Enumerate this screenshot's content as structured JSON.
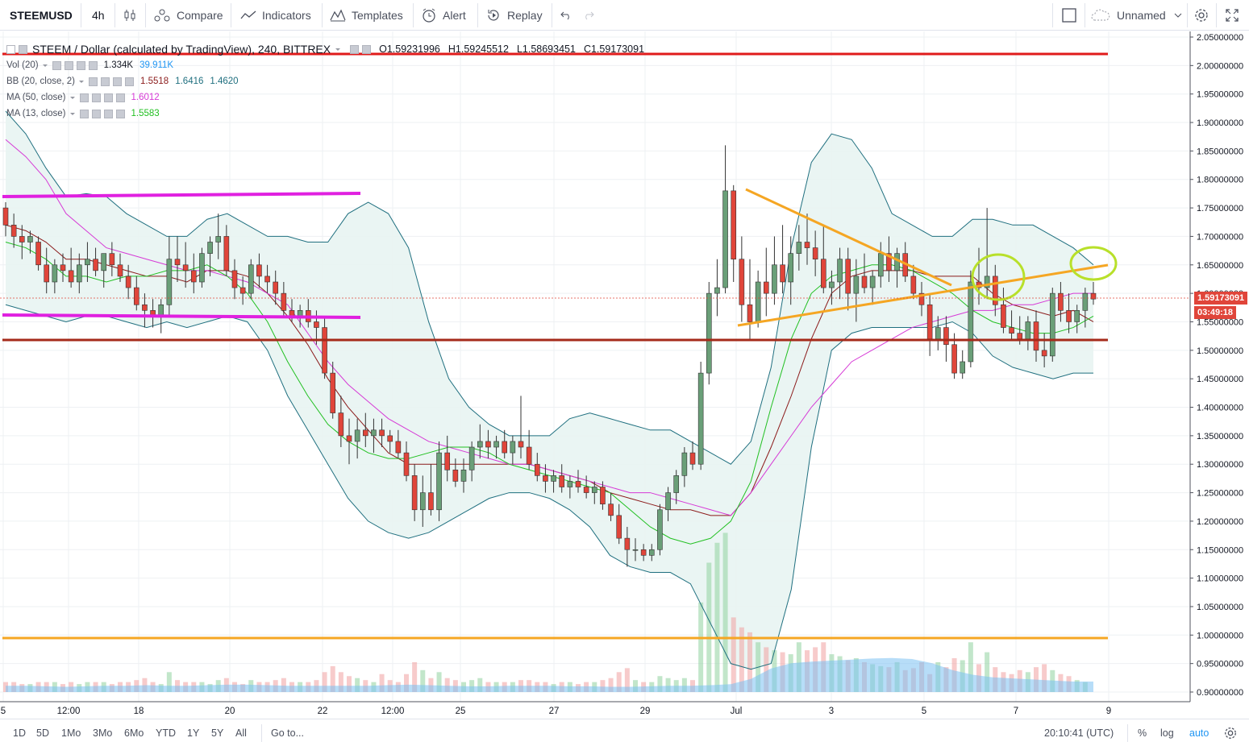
{
  "toolbar": {
    "symbol": "STEEMUSD",
    "interval": "4h",
    "compare_label": "Compare",
    "indicators_label": "Indicators",
    "templates_label": "Templates",
    "alert_label": "Alert",
    "replay_label": "Replay",
    "layout_name": "Unnamed"
  },
  "legend": {
    "title": "STEEM / Dollar (calculated by TradingView), 240, BITTREX",
    "open": "O1.59231996",
    "high": "H1.59245512",
    "low": "L1.58693451",
    "close": "C1.59173091",
    "indicators": [
      {
        "name": "Vol (20)",
        "values": [
          "1.334K",
          "39.911K"
        ],
        "colors": [
          "#131722",
          "#2196f3"
        ]
      },
      {
        "name": "BB (20, close, 2)",
        "values": [
          "1.5518",
          "1.6416",
          "1.4620"
        ],
        "colors": [
          "#8b1a1a",
          "#1f6f7f",
          "#1f6f7f"
        ]
      },
      {
        "name": "MA (50, close)",
        "values": [
          "1.6012"
        ],
        "colors": [
          "#d63ad6"
        ]
      },
      {
        "name": "MA (13, close)",
        "values": [
          "1.5583"
        ],
        "colors": [
          "#22c022"
        ]
      }
    ]
  },
  "price_axis": {
    "ticks": [
      "2.05000000",
      "2.00000000",
      "1.95000000",
      "1.90000000",
      "1.85000000",
      "1.80000000",
      "1.75000000",
      "1.70000000",
      "1.65000000",
      "1.60000000",
      "1.55000000",
      "1.50000000",
      "1.45000000",
      "1.40000000",
      "1.35000000",
      "1.30000000",
      "1.25000000",
      "1.20000000",
      "1.15000000",
      "1.10000000",
      "1.05000000",
      "1.00000000",
      "0.95000000",
      "0.90000000"
    ],
    "last_price": "1.59173091",
    "countdown": "03:49:18"
  },
  "time_axis": {
    "ticks": [
      "5",
      "12:00",
      "18",
      "20",
      "22",
      "12:00",
      "25",
      "27",
      "29",
      "Jul",
      "3",
      "5",
      "7",
      "9"
    ]
  },
  "bottom_bar": {
    "ranges": [
      "1D",
      "5D",
      "1Mo",
      "3Mo",
      "6Mo",
      "YTD",
      "1Y",
      "5Y",
      "All"
    ],
    "goto_label": "Go to...",
    "clock": "20:10:41 (UTC)",
    "percent_label": "%",
    "log_label": "log",
    "auto_label": "auto"
  },
  "colors": {
    "up_candle": "#6a9f78",
    "down_candle": "#e0453a",
    "red_line": "#e01b1b",
    "dark_red_line": "#a52a1a",
    "orange_line": "#f5a623",
    "magenta_line": "#e020e0",
    "highlight_circle": "#b8e02a",
    "bb_fill": "#e8f4f2",
    "bb_band": "#1f6f7f",
    "bb_basis": "#8b1a1a",
    "ma50": "#d63ad6",
    "ma13": "#22c022",
    "volume_up": "#8fd19e",
    "volume_down": "#f0a0a0",
    "volume_ma": "#7cc1f2"
  },
  "chart_data": {
    "type": "candlestick",
    "symbol": "STEEMUSD",
    "interval": "240",
    "ylim": [
      0.88,
      2.06
    ],
    "x_ticks": [
      "5",
      "12:00",
      "18",
      "20",
      "22",
      "12:00",
      "25",
      "27",
      "29",
      "Jul",
      "3",
      "5",
      "7",
      "9"
    ],
    "candles": [
      [
        1.75,
        1.76,
        1.7,
        1.72
      ],
      [
        1.72,
        1.74,
        1.68,
        1.7
      ],
      [
        1.7,
        1.72,
        1.66,
        1.69
      ],
      [
        1.69,
        1.71,
        1.67,
        1.7
      ],
      [
        1.69,
        1.7,
        1.64,
        1.65
      ],
      [
        1.65,
        1.68,
        1.6,
        1.62
      ],
      [
        1.62,
        1.66,
        1.6,
        1.65
      ],
      [
        1.65,
        1.67,
        1.62,
        1.64
      ],
      [
        1.64,
        1.68,
        1.61,
        1.62
      ],
      [
        1.62,
        1.67,
        1.6,
        1.65
      ],
      [
        1.65,
        1.69,
        1.62,
        1.66
      ],
      [
        1.66,
        1.68,
        1.63,
        1.64
      ],
      [
        1.64,
        1.67,
        1.61,
        1.67
      ],
      [
        1.67,
        1.69,
        1.63,
        1.65
      ],
      [
        1.65,
        1.67,
        1.62,
        1.63
      ],
      [
        1.63,
        1.65,
        1.59,
        1.61
      ],
      [
        1.61,
        1.63,
        1.57,
        1.58
      ],
      [
        1.58,
        1.6,
        1.54,
        1.57
      ],
      [
        1.57,
        1.59,
        1.54,
        1.56
      ],
      [
        1.56,
        1.59,
        1.53,
        1.58
      ],
      [
        1.58,
        1.7,
        1.56,
        1.66
      ],
      [
        1.66,
        1.7,
        1.62,
        1.65
      ],
      [
        1.65,
        1.69,
        1.61,
        1.64
      ],
      [
        1.64,
        1.67,
        1.6,
        1.62
      ],
      [
        1.62,
        1.68,
        1.61,
        1.67
      ],
      [
        1.67,
        1.7,
        1.63,
        1.69
      ],
      [
        1.69,
        1.74,
        1.66,
        1.7
      ],
      [
        1.7,
        1.72,
        1.63,
        1.64
      ],
      [
        1.64,
        1.66,
        1.59,
        1.61
      ],
      [
        1.61,
        1.63,
        1.58,
        1.6
      ],
      [
        1.6,
        1.66,
        1.59,
        1.65
      ],
      [
        1.65,
        1.67,
        1.61,
        1.63
      ],
      [
        1.63,
        1.65,
        1.6,
        1.62
      ],
      [
        1.62,
        1.64,
        1.58,
        1.6
      ],
      [
        1.6,
        1.62,
        1.56,
        1.57
      ],
      [
        1.57,
        1.59,
        1.55,
        1.56
      ],
      [
        1.56,
        1.58,
        1.54,
        1.57
      ],
      [
        1.57,
        1.59,
        1.54,
        1.55
      ],
      [
        1.55,
        1.57,
        1.51,
        1.54
      ],
      [
        1.54,
        1.56,
        1.45,
        1.46
      ],
      [
        1.46,
        1.48,
        1.38,
        1.39
      ],
      [
        1.39,
        1.42,
        1.33,
        1.35
      ],
      [
        1.35,
        1.38,
        1.3,
        1.34
      ],
      [
        1.34,
        1.38,
        1.31,
        1.36
      ],
      [
        1.36,
        1.39,
        1.33,
        1.35
      ],
      [
        1.35,
        1.38,
        1.32,
        1.36
      ],
      [
        1.36,
        1.38,
        1.33,
        1.35
      ],
      [
        1.35,
        1.36,
        1.32,
        1.34
      ],
      [
        1.34,
        1.36,
        1.31,
        1.32
      ],
      [
        1.32,
        1.34,
        1.27,
        1.28
      ],
      [
        1.28,
        1.3,
        1.2,
        1.22
      ],
      [
        1.22,
        1.28,
        1.19,
        1.25
      ],
      [
        1.25,
        1.3,
        1.21,
        1.22
      ],
      [
        1.22,
        1.34,
        1.2,
        1.32
      ],
      [
        1.32,
        1.35,
        1.27,
        1.29
      ],
      [
        1.29,
        1.31,
        1.26,
        1.27
      ],
      [
        1.27,
        1.31,
        1.25,
        1.29
      ],
      [
        1.29,
        1.34,
        1.27,
        1.33
      ],
      [
        1.33,
        1.37,
        1.31,
        1.34
      ],
      [
        1.34,
        1.36,
        1.31,
        1.33
      ],
      [
        1.33,
        1.35,
        1.31,
        1.34
      ],
      [
        1.34,
        1.36,
        1.31,
        1.32
      ],
      [
        1.32,
        1.35,
        1.3,
        1.34
      ],
      [
        1.34,
        1.42,
        1.31,
        1.33
      ],
      [
        1.33,
        1.36,
        1.29,
        1.3
      ],
      [
        1.3,
        1.32,
        1.27,
        1.28
      ],
      [
        1.28,
        1.3,
        1.25,
        1.27
      ],
      [
        1.27,
        1.29,
        1.25,
        1.28
      ],
      [
        1.28,
        1.3,
        1.25,
        1.26
      ],
      [
        1.26,
        1.28,
        1.24,
        1.27
      ],
      [
        1.27,
        1.29,
        1.25,
        1.26
      ],
      [
        1.26,
        1.28,
        1.24,
        1.25
      ],
      [
        1.25,
        1.27,
        1.23,
        1.26
      ],
      [
        1.26,
        1.27,
        1.22,
        1.23
      ],
      [
        1.23,
        1.25,
        1.2,
        1.21
      ],
      [
        1.21,
        1.23,
        1.16,
        1.17
      ],
      [
        1.17,
        1.19,
        1.12,
        1.15
      ],
      [
        1.15,
        1.17,
        1.13,
        1.15
      ],
      [
        1.15,
        1.16,
        1.13,
        1.14
      ],
      [
        1.14,
        1.16,
        1.13,
        1.15
      ],
      [
        1.15,
        1.23,
        1.14,
        1.22
      ],
      [
        1.22,
        1.26,
        1.2,
        1.25
      ],
      [
        1.25,
        1.29,
        1.23,
        1.28
      ],
      [
        1.28,
        1.33,
        1.26,
        1.32
      ],
      [
        1.32,
        1.34,
        1.29,
        1.3
      ],
      [
        1.3,
        1.48,
        1.29,
        1.46
      ],
      [
        1.46,
        1.62,
        1.44,
        1.6
      ],
      [
        1.6,
        1.66,
        1.56,
        1.61
      ],
      [
        1.61,
        1.86,
        1.6,
        1.78
      ],
      [
        1.78,
        1.79,
        1.62,
        1.66
      ],
      [
        1.66,
        1.7,
        1.55,
        1.58
      ],
      [
        1.58,
        1.66,
        1.52,
        1.55
      ],
      [
        1.55,
        1.64,
        1.54,
        1.62
      ],
      [
        1.62,
        1.68,
        1.56,
        1.6
      ],
      [
        1.6,
        1.7,
        1.58,
        1.65
      ],
      [
        1.65,
        1.72,
        1.6,
        1.62
      ],
      [
        1.62,
        1.7,
        1.58,
        1.67
      ],
      [
        1.67,
        1.72,
        1.64,
        1.69
      ],
      [
        1.69,
        1.74,
        1.65,
        1.68
      ],
      [
        1.68,
        1.71,
        1.63,
        1.66
      ],
      [
        1.66,
        1.72,
        1.6,
        1.61
      ],
      [
        1.61,
        1.64,
        1.58,
        1.62
      ],
      [
        1.62,
        1.68,
        1.59,
        1.66
      ],
      [
        1.66,
        1.68,
        1.57,
        1.6
      ],
      [
        1.6,
        1.66,
        1.55,
        1.63
      ],
      [
        1.63,
        1.67,
        1.6,
        1.61
      ],
      [
        1.61,
        1.64,
        1.58,
        1.63
      ],
      [
        1.63,
        1.69,
        1.61,
        1.67
      ],
      [
        1.67,
        1.7,
        1.62,
        1.64
      ],
      [
        1.64,
        1.68,
        1.61,
        1.67
      ],
      [
        1.67,
        1.69,
        1.62,
        1.63
      ],
      [
        1.63,
        1.65,
        1.59,
        1.6
      ],
      [
        1.6,
        1.62,
        1.56,
        1.58
      ],
      [
        1.58,
        1.6,
        1.49,
        1.52
      ],
      [
        1.52,
        1.56,
        1.5,
        1.54
      ],
      [
        1.54,
        1.56,
        1.48,
        1.51
      ],
      [
        1.51,
        1.53,
        1.45,
        1.46
      ],
      [
        1.46,
        1.5,
        1.45,
        1.48
      ],
      [
        1.48,
        1.64,
        1.47,
        1.62
      ],
      [
        1.62,
        1.68,
        1.58,
        1.61
      ],
      [
        1.61,
        1.75,
        1.59,
        1.63
      ],
      [
        1.63,
        1.65,
        1.56,
        1.58
      ],
      [
        1.58,
        1.61,
        1.53,
        1.54
      ],
      [
        1.54,
        1.57,
        1.52,
        1.53
      ],
      [
        1.53,
        1.56,
        1.51,
        1.52
      ],
      [
        1.52,
        1.56,
        1.5,
        1.55
      ],
      [
        1.55,
        1.57,
        1.48,
        1.5
      ],
      [
        1.5,
        1.53,
        1.47,
        1.49
      ],
      [
        1.49,
        1.61,
        1.48,
        1.6
      ],
      [
        1.6,
        1.62,
        1.55,
        1.57
      ],
      [
        1.57,
        1.6,
        1.53,
        1.55
      ],
      [
        1.55,
        1.58,
        1.53,
        1.57
      ],
      [
        1.57,
        1.61,
        1.54,
        1.6
      ],
      [
        1.6,
        1.62,
        1.58,
        1.59
      ]
    ],
    "volume_relative": [
      0.1,
      0.1,
      0.08,
      0.08,
      0.1,
      0.1,
      0.1,
      0.08,
      0.1,
      0.08,
      0.1,
      0.1,
      0.1,
      0.08,
      0.1,
      0.1,
      0.12,
      0.14,
      0.1,
      0.08,
      0.2,
      0.12,
      0.1,
      0.1,
      0.1,
      0.08,
      0.12,
      0.14,
      0.1,
      0.08,
      0.12,
      0.1,
      0.1,
      0.12,
      0.14,
      0.1,
      0.1,
      0.1,
      0.12,
      0.2,
      0.26,
      0.2,
      0.16,
      0.14,
      0.12,
      0.1,
      0.18,
      0.12,
      0.1,
      0.18,
      0.3,
      0.22,
      0.14,
      0.2,
      0.14,
      0.12,
      0.1,
      0.12,
      0.14,
      0.1,
      0.1,
      0.1,
      0.1,
      0.12,
      0.12,
      0.1,
      0.1,
      0.08,
      0.1,
      0.1,
      0.08,
      0.1,
      0.1,
      0.12,
      0.14,
      0.2,
      0.24,
      0.12,
      0.1,
      0.1,
      0.16,
      0.14,
      0.12,
      0.14,
      0.12,
      0.9,
      1.3,
      1.5,
      1.6,
      0.75,
      0.65,
      0.6,
      0.5,
      0.45,
      0.42,
      0.4,
      0.38,
      0.5,
      0.42,
      0.45,
      0.5,
      0.38,
      0.36,
      0.32,
      0.34,
      0.3,
      0.28,
      0.26,
      0.25,
      0.3,
      0.22,
      0.24,
      0.3,
      0.18,
      0.3,
      0.25,
      0.34,
      0.32,
      0.5,
      0.28,
      0.4,
      0.25,
      0.2,
      0.18,
      0.22,
      0.2,
      0.25,
      0.28,
      0.22,
      0.18,
      0.16,
      0.12,
      0.1
    ],
    "bb_upper": [
      1.92,
      1.88,
      1.82,
      1.77,
      1.775,
      1.77,
      1.74,
      1.72,
      1.7,
      1.7,
      1.73,
      1.74,
      1.72,
      1.7,
      1.7,
      1.69,
      1.69,
      1.74,
      1.76,
      1.74,
      1.68,
      1.55,
      1.45,
      1.4,
      1.37,
      1.35,
      1.35,
      1.35,
      1.38,
      1.39,
      1.38,
      1.37,
      1.36,
      1.36,
      1.34,
      1.32,
      1.3,
      1.34,
      1.47,
      1.68,
      1.83,
      1.88,
      1.87,
      1.82,
      1.74,
      1.72,
      1.7,
      1.7,
      1.73,
      1.73,
      1.72,
      1.72,
      1.7,
      1.68,
      1.65
    ],
    "bb_lower": [
      1.58,
      1.57,
      1.56,
      1.55,
      1.56,
      1.56,
      1.55,
      1.54,
      1.55,
      1.54,
      1.55,
      1.56,
      1.55,
      1.5,
      1.42,
      1.36,
      1.3,
      1.24,
      1.2,
      1.18,
      1.17,
      1.18,
      1.2,
      1.22,
      1.24,
      1.25,
      1.25,
      1.24,
      1.22,
      1.19,
      1.14,
      1.12,
      1.11,
      1.11,
      1.09,
      1.02,
      0.95,
      0.94,
      0.95,
      1.08,
      1.33,
      1.5,
      1.53,
      1.54,
      1.54,
      1.54,
      1.54,
      1.55,
      1.53,
      1.49,
      1.47,
      1.46,
      1.45,
      1.46,
      1.46
    ],
    "bb_basis": [
      1.72,
      1.71,
      1.69,
      1.66,
      1.66,
      1.65,
      1.64,
      1.63,
      1.63,
      1.62,
      1.64,
      1.64,
      1.63,
      1.6,
      1.56,
      1.51,
      1.45,
      1.4,
      1.36,
      1.32,
      1.3,
      1.3,
      1.3,
      1.3,
      1.3,
      1.3,
      1.3,
      1.29,
      1.28,
      1.27,
      1.25,
      1.24,
      1.23,
      1.22,
      1.22,
      1.21,
      1.21,
      1.25,
      1.33,
      1.42,
      1.52,
      1.6,
      1.63,
      1.64,
      1.64,
      1.64,
      1.63,
      1.63,
      1.63,
      1.6,
      1.58,
      1.57,
      1.56,
      1.57,
      1.55
    ],
    "ma50": [
      1.87,
      1.84,
      1.8,
      1.74,
      1.71,
      1.68,
      1.67,
      1.66,
      1.65,
      1.64,
      1.64,
      1.63,
      1.62,
      1.6,
      1.58,
      1.53,
      1.48,
      1.44,
      1.41,
      1.38,
      1.36,
      1.34,
      1.33,
      1.32,
      1.31,
      1.3,
      1.3,
      1.29,
      1.28,
      1.27,
      1.26,
      1.25,
      1.25,
      1.24,
      1.23,
      1.22,
      1.21,
      1.25,
      1.3,
      1.35,
      1.4,
      1.44,
      1.48,
      1.5,
      1.52,
      1.54,
      1.55,
      1.56,
      1.57,
      1.57,
      1.58,
      1.58,
      1.59,
      1.6,
      1.6
    ],
    "ma13": [
      1.69,
      1.68,
      1.66,
      1.63,
      1.63,
      1.62,
      1.63,
      1.63,
      1.64,
      1.64,
      1.65,
      1.63,
      1.6,
      1.55,
      1.48,
      1.42,
      1.37,
      1.34,
      1.32,
      1.31,
      1.31,
      1.32,
      1.33,
      1.33,
      1.32,
      1.3,
      1.29,
      1.28,
      1.27,
      1.26,
      1.25,
      1.22,
      1.19,
      1.17,
      1.16,
      1.17,
      1.2,
      1.27,
      1.4,
      1.52,
      1.6,
      1.63,
      1.64,
      1.65,
      1.65,
      1.64,
      1.62,
      1.6,
      1.57,
      1.55,
      1.54,
      1.53,
      1.53,
      1.54,
      1.56
    ]
  }
}
